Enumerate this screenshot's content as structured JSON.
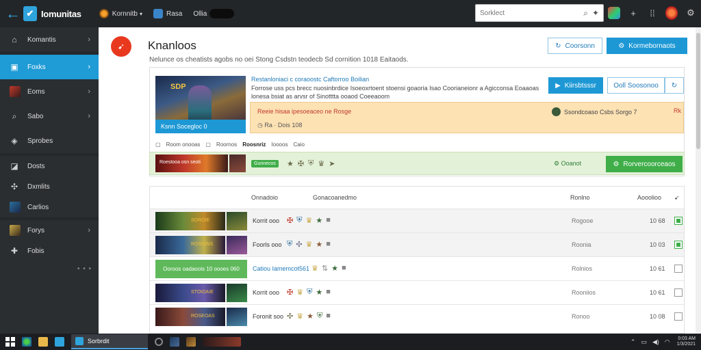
{
  "app": {
    "name": "Iomunitas"
  },
  "topnav": {
    "item1": "Kornnitb",
    "item2": "Rasa",
    "item3": "Ollia"
  },
  "search": {
    "placeholder": "Sorklect"
  },
  "sidebar": {
    "items": [
      {
        "label": "Komantis"
      },
      {
        "label": "Foxks"
      },
      {
        "label": "Eoms"
      },
      {
        "label": "Sabo"
      },
      {
        "label": "Sprobes"
      },
      {
        "label": "Dosts"
      },
      {
        "label": "Dxmlits"
      },
      {
        "label": "Carlios"
      },
      {
        "label": "Forys"
      },
      {
        "label": "Fobis"
      }
    ],
    "more": "• • •"
  },
  "page": {
    "title": "Knanloos",
    "description": "Nelunce os cheatists agobs no oei Stong Csdstn teodecb Sd cornition 1018 Eaitaods."
  },
  "header_buttons": {
    "outline": "Coorsonn",
    "primary": "Kormebornaots"
  },
  "feature": {
    "caption": "Ksnn Socegloc 0",
    "badge": "SDP",
    "title": "Restanloniaci c coraoostc Caftorroo Boilian",
    "text": "Forrose uss pcs brecc nuosinbrdice Isoeoxrtoent stoensi goaoria Isao Coorianeionr a Agicconsa Eoaaoas lonesa bsiat as arvsr of Sinotttta ooaod Coeeaoom",
    "btn_primary": "Kiirsbtsssr",
    "btn_outline": "Ooll Soosonoo",
    "warn_title": "Reeie hisaa ipesoeaceo ne Rosge",
    "warn_timer": "Ra · Dois 108",
    "warn_right": "Ssondcoaso Csbs Sorgo 7",
    "warn_close": "Rk",
    "sub1": "Room onooas",
    "sub2": "Roornos",
    "sub_strong": "Roosnriz",
    "sub3": "Ioooos",
    "sub4": "Caio"
  },
  "green_band": {
    "image_text": "Roestooa osn seoti",
    "badge": "Gunnecos",
    "label": "Ooanot",
    "button": "Rorvercoorceaos"
  },
  "table": {
    "headers": {
      "col1": "Onnadoio",
      "col2": "Gonacoanedmo",
      "col3": "Ronlno",
      "col4": "Aooolioo"
    },
    "rows": [
      {
        "name": "Korrit ooo",
        "image_text": "SOROIE",
        "status": "Rogooe",
        "value": "10 68",
        "checked": true
      },
      {
        "name": "Foorls ooo",
        "image_text": "ROSIONS",
        "status": "Roonia",
        "value": "10 03",
        "checked": true
      },
      {
        "name": "Catiou Iamemcot561",
        "image_text": "Ooroos oadaoois 10 oooes 060",
        "status": "Rolnios",
        "value": "10 61",
        "checked": false
      },
      {
        "name": "Korrit ooo",
        "image_text": "STOIOAIE",
        "status": "Rooniios",
        "value": "10 61",
        "checked": false
      },
      {
        "name": "Foronit soo",
        "image_text": "ROSEOAS",
        "status": "Ronoo",
        "value": "10 08",
        "checked": false
      }
    ]
  },
  "taskbar": {
    "app": "Sorbrdit",
    "clock_time": "0:03 AM",
    "clock_date": "1/3/2021"
  }
}
